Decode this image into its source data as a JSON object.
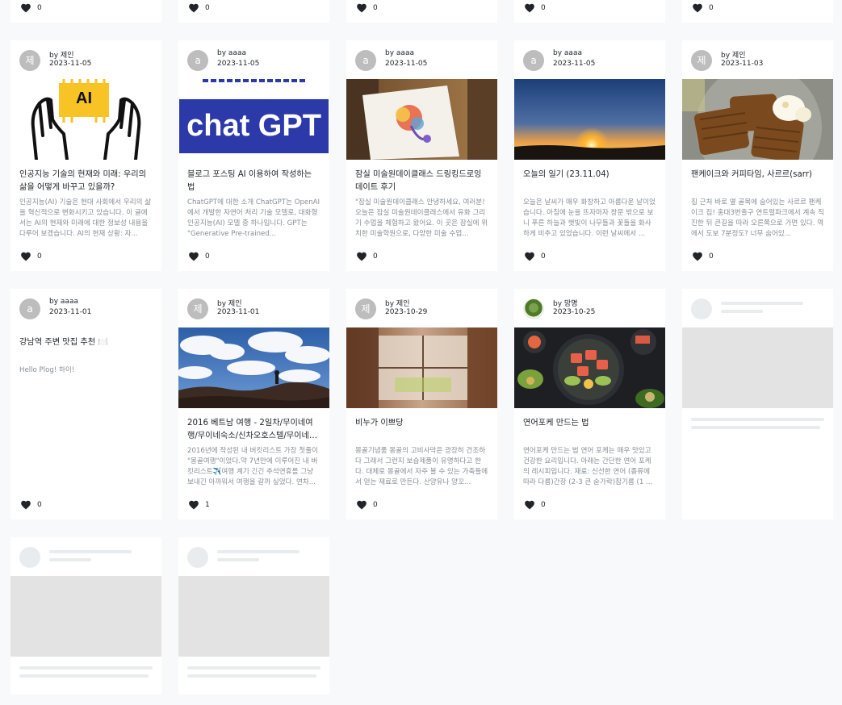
{
  "top_row": [
    {
      "likes": "0"
    },
    {
      "likes": "0"
    },
    {
      "likes": "0"
    },
    {
      "likes": "0"
    },
    {
      "likes": "0"
    }
  ],
  "posts": [
    {
      "author_prefix": "by",
      "author": "제인",
      "avatar_letter": "제",
      "date": "2023-11-05",
      "image": "ai-hands-illustration",
      "title": "인공지능 기술의 현재와 미래: 우리의 삶을 어떻게 바꾸고 있을까?",
      "description": "인공지능(AI) 기술은 현대 사회에서 우리의 삶을 혁신적으로 변화시키고 있습니다. 이 글에서는 AI의 현재와 미래에 대한 정보성 내용을 다루어 보겠습니다. AI의 현재 상황: 자...",
      "likes": "0",
      "ai_badge": "AI"
    },
    {
      "author_prefix": "by",
      "author": "aaaa",
      "avatar_letter": "a",
      "date": "2023-11-05",
      "image": "chat-gpt-banner",
      "banner_text": "chat GPT",
      "title": "블로그 포스팅 AI 이용하여 작성하는 법",
      "description": "ChatGPT에 대한 소개 ChatGPT는 OpenAI에서 개발한 자연어 처리 기술 모델로, 대화형 인공지능(AI) 모델 중 하나입니다. GPT는 \"Generative Pre-trained...",
      "likes": "0"
    },
    {
      "author_prefix": "by",
      "author": "aaaa",
      "avatar_letter": "a",
      "date": "2023-11-05",
      "image": "drawing-on-easel",
      "title": "잠실 미술원데이클래스 드링킹드로잉 데이트 후기",
      "description": "\"잠실 미술원데이클래스 안녕하세요, 여러분! 오늘은 잠실 미술원데이클래스에서 유화 그리기 수업을 체험하고 왔어요. 이 곳은 잠실에 위치한 미술학원으로, 다양한 미술 수업...",
      "likes": "0"
    },
    {
      "author_prefix": "by",
      "author": "aaaa",
      "avatar_letter": "a",
      "date": "2023-11-05",
      "image": "sunset-landscape",
      "title": "오늘의 일기 (23.11.04)",
      "description": "오늘은 날씨가 매우 화창하고 아름다운 날이었습니다. 아침에 눈을 뜨자마자 창문 밖으로 보니 푸른 하늘과 햇빛이 나무들과 꽃들을 화사하게 비추고 있었습니다. 이런 날씨에서 ...",
      "likes": "0"
    },
    {
      "author_prefix": "by",
      "author": "제인",
      "avatar_letter": "제",
      "date": "2023-11-03",
      "image": "waffles-plate",
      "title": "팬케이크와 커피타임, 사르르(sarr)",
      "description": "집 근처 바로 옆 골목에 숨어있는 사르르 팬케이크 집! 홍대3번출구 연트럴파크에서 계속 직진한 뒤 큰길을 따라 오른쪽으로 가면 있다. 역에서 도보 7분정도? 너무 숨어있...",
      "likes": "0"
    },
    {
      "author_prefix": "by",
      "author": "aaaa",
      "avatar_letter": "a",
      "date": "2023-11-01",
      "image": "",
      "title": "강남역 주변 맛집 추천 🍽️",
      "description": "Hello Plog! 하이!",
      "likes": "0"
    },
    {
      "author_prefix": "by",
      "author": "제인",
      "avatar_letter": "제",
      "date": "2023-11-01",
      "image": "sky-rocks-landscape",
      "title": "2016 베트남 여행 - 2일차/무이네여행/무이네숙소/신차오호스텔/무이네맛...",
      "description": "2016년에 작성된 내 버킷리스트 가장 첫줄이 \"몽골여행\"이었다.약 7년만에 이루어진 내 버킷리스트✈️여행 계기 긴긴 추석연휴를 그냥 보내긴 아까워서 여행을 갈까 싶었다. 연차...",
      "likes": "1"
    },
    {
      "author_prefix": "by",
      "author": "제인",
      "avatar_letter": "제",
      "date": "2023-10-29",
      "image": "window-curtain",
      "title": "비누가 이쁘당",
      "description": "몽골기념품 몽골의 고비사막은 광장히 건조하다 그래서 그런지 보습제품이 유명하다고 한다. 대체로 몽골에서 자주 볼 수 있는 가축들에서 얻는 재료로 만든다. 산양유나 양꼬...",
      "likes": "0"
    },
    {
      "author_prefix": "by",
      "author": "망명",
      "avatar_letter": "",
      "date": "2023-10-25",
      "image": "poke-bowl",
      "title": "연어포케 만드는 법",
      "description": "연어포케 만드는 법 연어 포케는 매우 맛있고 건강한 요리입니다. 아래는 간단한 연어 포케의 레시피입니다. 재료: 신선한 연어 (종류에 따라 다름)간장 (2-3 큰 숟가락)참기름 (1 ...",
      "likes": "0"
    }
  ],
  "colors": {
    "background": "#f8f9fa",
    "card": "#ffffff",
    "avatar": "#bdbdbd",
    "muted_text": "#868e96",
    "skeleton": "#e9ecef"
  }
}
